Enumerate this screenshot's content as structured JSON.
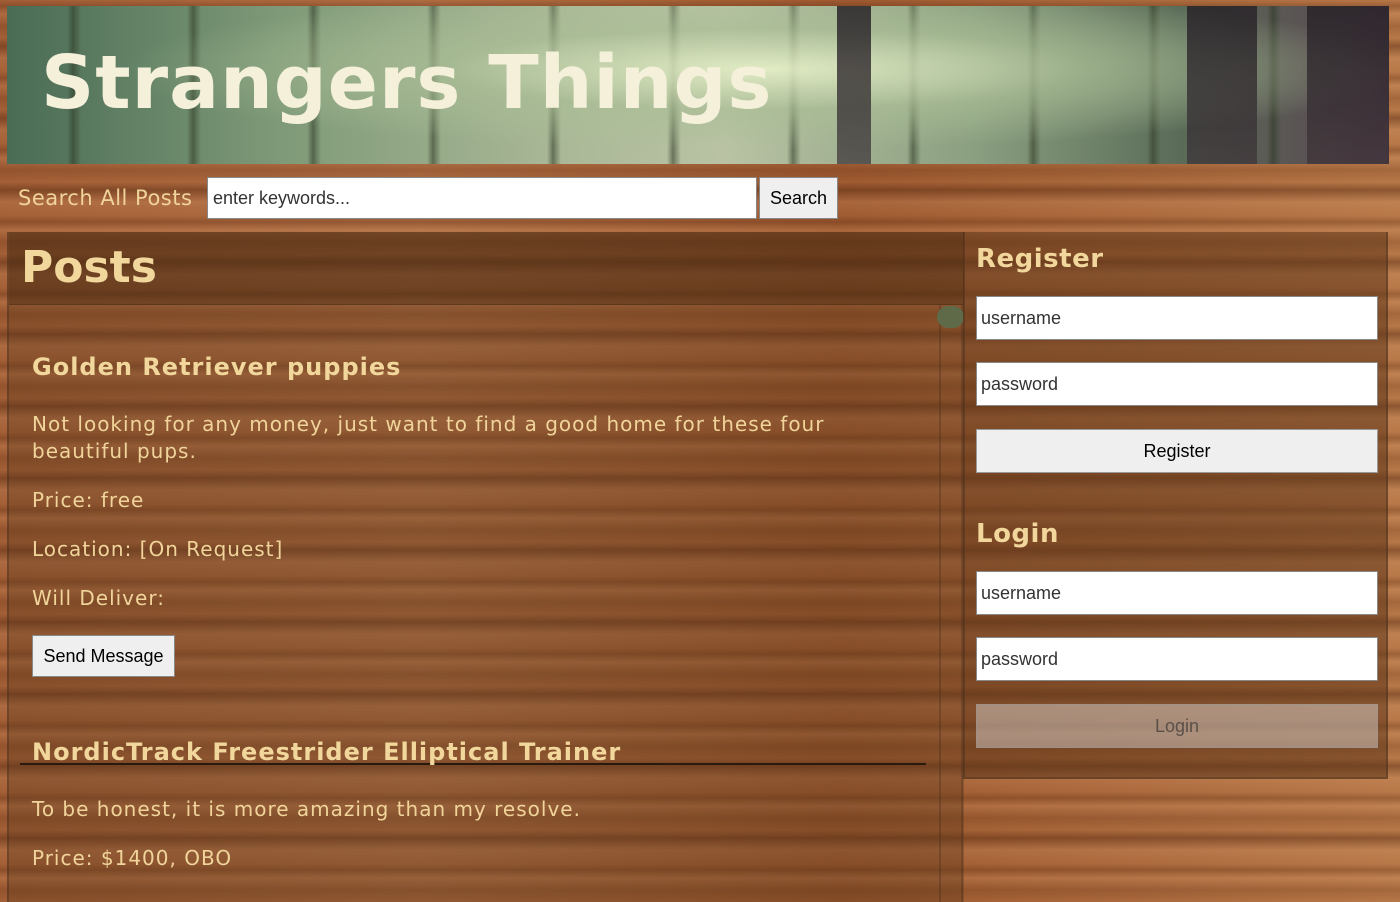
{
  "header": {
    "title": "Strangers Things"
  },
  "search": {
    "label": "Search All Posts",
    "placeholder": "enter keywords...",
    "button_label": "Search"
  },
  "posts_section": {
    "title": "Posts",
    "posts": [
      {
        "title": "Golden Retriever puppies",
        "description": "Not looking for any money, just want to find a good home for these four beautiful pups.",
        "price": "Price: free",
        "location": "Location: [On Request]",
        "will_deliver": "Will Deliver:",
        "button_label": "Send Message"
      },
      {
        "title": "NordicTrack Freestrider Elliptical Trainer",
        "description": "To be honest, it is more amazing than my resolve.",
        "price": "Price: $1400, OBO"
      }
    ]
  },
  "register": {
    "heading": "Register",
    "username_placeholder": "username",
    "password_placeholder": "password",
    "button_label": "Register"
  },
  "login": {
    "heading": "Login",
    "username_placeholder": "username",
    "password_placeholder": "password",
    "button_label": "Login"
  }
}
